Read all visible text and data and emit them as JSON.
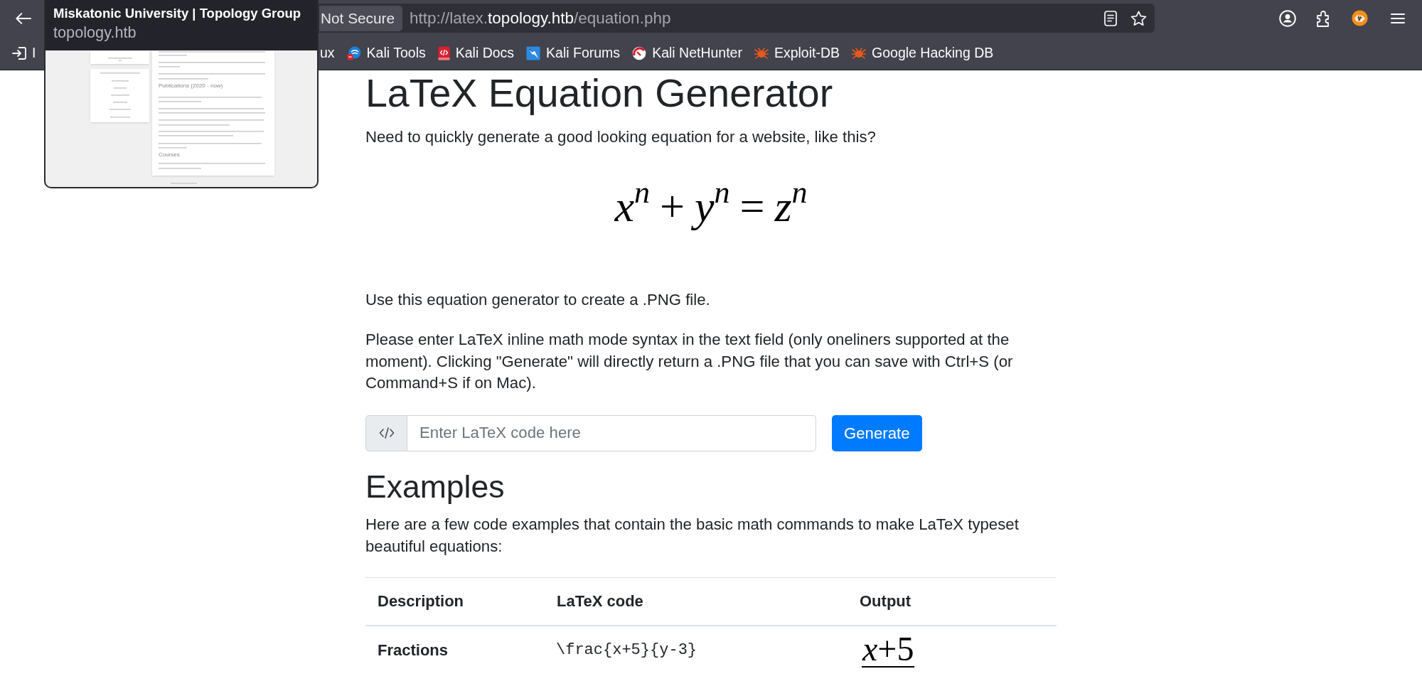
{
  "toolbar": {
    "security": "Not Secure",
    "url": {
      "start": "http://latex.",
      "host": "topology.htb",
      "end": "/equation.php"
    }
  },
  "bookmarks": [
    {
      "kind": "import",
      "label": "I"
    },
    {
      "kind": "text",
      "label": "ux"
    },
    {
      "kind": "tools",
      "label": "Kali Tools"
    },
    {
      "kind": "docs",
      "label": "Kali Docs"
    },
    {
      "kind": "forums",
      "label": "Kali Forums"
    },
    {
      "kind": "nethunter",
      "label": "Kali NetHunter"
    },
    {
      "kind": "bug",
      "label": "Exploit-DB"
    },
    {
      "kind": "bug",
      "label": "Google Hacking DB"
    }
  ],
  "tab_preview": {
    "title": "Miskatonic University | Topology Group",
    "host": "topology.htb",
    "thumbnail_headings": [
      "Publications (2020 - now)",
      "Courses"
    ]
  },
  "page": {
    "title": "LaTeX Equation Generator",
    "intro": "Need to quickly generate a good looking equation for a website, like this?",
    "sample_equation": [
      {
        "kind": "var",
        "text": "x",
        "sup": "n"
      },
      {
        "kind": "op",
        "text": "+"
      },
      {
        "kind": "var",
        "text": "y",
        "sup": "n"
      },
      {
        "kind": "op",
        "text": "="
      },
      {
        "kind": "var",
        "text": "z",
        "sup": "n"
      }
    ],
    "paragraphs": [
      "Use this equation generator to create a .PNG file.",
      "Please enter LaTeX inline math mode syntax in the text field (only oneliners supported at the moment). Clicking \"Generate\" will directly return a .PNG file that you can save with Ctrl+S (or Command+S if on Mac)."
    ],
    "form": {
      "placeholder": "Enter LaTeX code here",
      "button": "Generate"
    },
    "examples": {
      "heading": "Examples",
      "intro": "Here are a few code examples that contain the basic math commands to make LaTeX typeset beautiful equations:",
      "table": {
        "columns": [
          "Description",
          "LaTeX code",
          "Output"
        ],
        "rows": [
          {
            "description": "Fractions",
            "code": "\\frac{x+5}{y-3}",
            "output": {
              "kind": "fraction",
              "numerator": "*x*+5"
            }
          }
        ]
      }
    }
  }
}
